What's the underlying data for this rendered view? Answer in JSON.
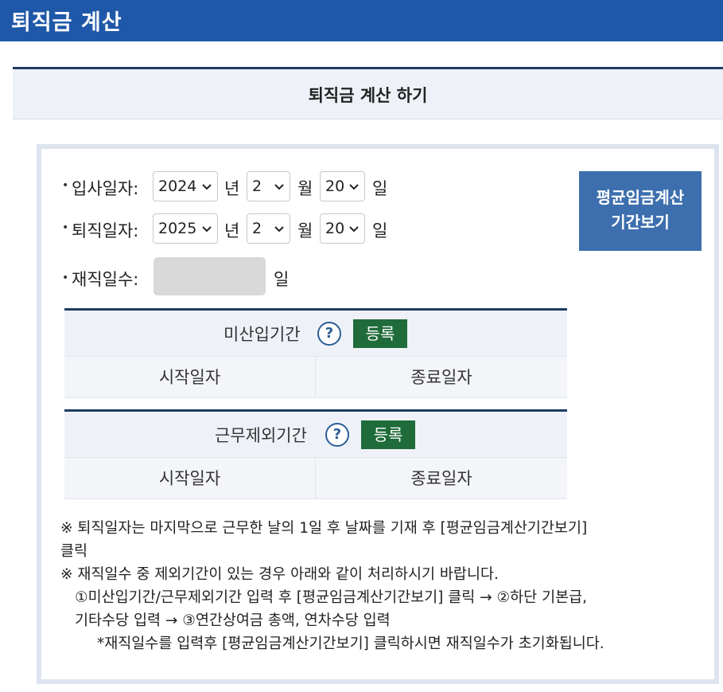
{
  "header": {
    "title": "퇴직금 계산"
  },
  "section": {
    "title": "퇴직금 계산 하기"
  },
  "form": {
    "bullet": "•",
    "join": {
      "label": "입사일자:",
      "year": "2024",
      "month": "2",
      "day": "20",
      "year_unit": "년",
      "month_unit": "월",
      "day_unit": "일"
    },
    "leave": {
      "label": "퇴직일자:",
      "year": "2025",
      "month": "2",
      "day": "20",
      "year_unit": "년",
      "month_unit": "월",
      "day_unit": "일"
    },
    "tenure": {
      "label": "재직일수:",
      "value": "",
      "unit": "일"
    }
  },
  "avg_button": {
    "line1": "평균임금계산",
    "line2": "기간보기"
  },
  "unpaid_period": {
    "title": "미산입기간",
    "help": "?",
    "register": "등록",
    "start": "시작일자",
    "end": "종료일자"
  },
  "excluded_period": {
    "title": "근무제외기간",
    "help": "?",
    "register": "등록",
    "start": "시작일자",
    "end": "종료일자"
  },
  "notes": [
    "※ 퇴직일자는 마지막으로 근무한 날의 1일 후 날짜를 기재 후 [평균임금계산기간보기]",
    "클릭",
    "※ 재직일수 중 제외기간이 있는 경우 아래와 같이 처리하시기 바랍니다.",
    "①미산입기간/근무제외기간 입력 후 [평균임금계산기간보기] 클릭 → ②하단 기본급,",
    "기타수당 입력 → ③연간상여금 총액, 연차수당 입력",
    "*재직일수를 입력후 [평균임금계산기간보기] 클릭하시면 재직일수가 초기화됩니다."
  ],
  "colors": {
    "topbar": "#1f58a8",
    "button": "#3d6fae",
    "register": "#1f6b3a",
    "rule": "#1e3d64"
  }
}
